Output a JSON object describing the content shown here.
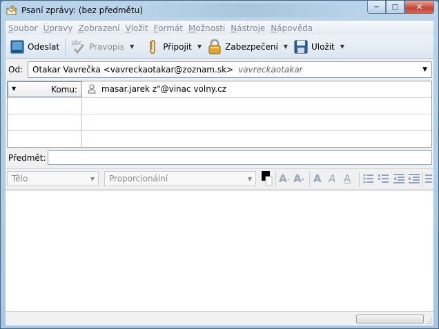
{
  "window": {
    "title": "Psaní zprávy: (bez předmětu)",
    "controls": {
      "minimize": "−",
      "maximize": "□",
      "close": "✕"
    }
  },
  "menubar": {
    "items": [
      {
        "label": "Soubor",
        "key": "S"
      },
      {
        "label": "Úpravy",
        "key": "Ú"
      },
      {
        "label": "Zobrazení",
        "key": "Z"
      },
      {
        "label": "Vložit",
        "key": "V"
      },
      {
        "label": "Formát",
        "key": "F"
      },
      {
        "label": "Možnosti",
        "key": "M"
      },
      {
        "label": "Nástroje",
        "key": "N"
      },
      {
        "label": "Nápověda",
        "key": "N"
      }
    ]
  },
  "toolbar": {
    "send_label": "Odeslat",
    "spell_label": "Pravopis",
    "spell_icon_text": "abc",
    "attach_label": "Připojit",
    "security_label": "Zabezpečení",
    "save_label": "Uložit"
  },
  "from": {
    "label": "Od:",
    "value": "Otakar Vavrečka <vavreckaotakar@zoznam.sk>",
    "alias": "vavreckaotakar"
  },
  "recipients": {
    "rows": [
      {
        "type": "Komu:",
        "value": "masar.jarek z\"@vinac volny.cz"
      },
      {
        "type": "",
        "value": ""
      },
      {
        "type": "",
        "value": ""
      },
      {
        "type": "",
        "value": ""
      }
    ]
  },
  "subject": {
    "label": "Předmět:",
    "value": ""
  },
  "format": {
    "paragraph_style": "Tělo",
    "font": "Proporcionální",
    "text_color": "#000000",
    "icons": [
      "font-smaller-icon",
      "font-larger-icon",
      "bold-icon",
      "italic-icon",
      "underline-icon",
      "bullet-list-icon",
      "numbered-list-icon",
      "outdent-icon",
      "indent-icon",
      "align-icon"
    ]
  },
  "editor": {
    "content": ""
  }
}
